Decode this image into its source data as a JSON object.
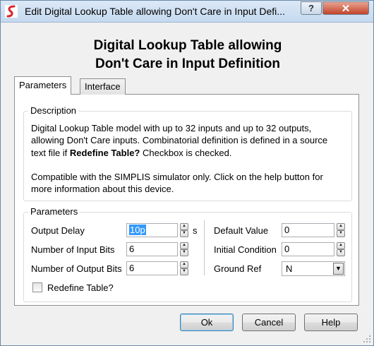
{
  "window": {
    "title": "Edit Digital Lookup Table allowing Don't Care in Input Defi...",
    "help_label": "?",
    "close_label": "✕"
  },
  "heading": {
    "line1": "Digital Lookup Table allowing",
    "line2": "Don't Care in Input Definition"
  },
  "tabs": [
    {
      "label": "Parameters",
      "active": true
    },
    {
      "label": "Interface",
      "active": false
    }
  ],
  "description": {
    "title": "Description",
    "line1": "Digital Lookup Table model with up to 32 inputs and up to 32 outputs,",
    "line2": "allowing Don't Care inputs. Combinatorial definition is defined in a source",
    "line3_pre": "text file if ",
    "line3_bold": "Redefine Table?",
    "line3_post": " Checkbox is checked.",
    "line4": "Compatible with the SIMPLIS simulator only. Click on the help button for",
    "line5": "more information about this device."
  },
  "parameters": {
    "title": "Parameters",
    "output_delay": {
      "label": "Output Delay",
      "value": "10p",
      "unit": "s"
    },
    "num_input_bits": {
      "label": "Number of Input Bits",
      "value": "6"
    },
    "num_output_bits": {
      "label": "Number of Output Bits",
      "value": "6"
    },
    "default_value": {
      "label": "Default Value",
      "value": "0"
    },
    "initial_condition": {
      "label": "Initial Condition",
      "value": "0"
    },
    "ground_ref": {
      "label": "Ground Ref",
      "value": "N"
    },
    "redefine_table": {
      "label": "Redefine Table?",
      "checked": false
    }
  },
  "buttons": {
    "ok": "Ok",
    "cancel": "Cancel",
    "help": "Help"
  },
  "colors": {
    "app_icon_red": "#d9262b",
    "close_red": "#c2442b",
    "selection": "#3399ff"
  },
  "icons": {
    "app": "simetrix-logo-icon",
    "grip": "resize-grip-icon"
  }
}
